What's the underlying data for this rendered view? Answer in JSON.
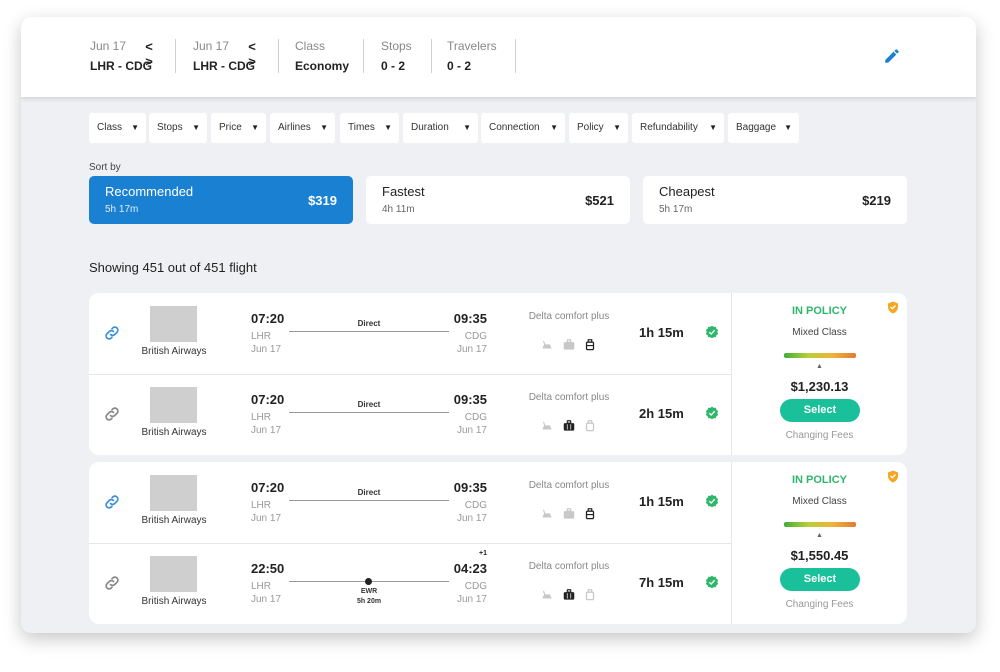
{
  "search": {
    "outbound_date": "Jun 17",
    "outbound_route": "LHR - CDG",
    "return_date": "Jun 17",
    "return_route": "LHR - CDG",
    "prev_glyph": "<",
    "next_glyph": ">",
    "class_label": "Class",
    "class_value": "Economy",
    "stops_label": "Stops",
    "stops_value": "0 - 2",
    "travelers_label": "Travelers",
    "travelers_value": "0 - 2",
    "edit_icon": "pencil-icon"
  },
  "filters": [
    "Class",
    "Stops",
    "Price",
    "Airlines",
    "Times",
    "Duration",
    "Connection",
    "Policy",
    "Refundability",
    "Baggage"
  ],
  "filter_caret": "▼",
  "sort": {
    "label": "Sort by",
    "options": [
      {
        "name": "Recommended",
        "duration": "5h 17m",
        "price": "$319"
      },
      {
        "name": "Fastest",
        "duration": "4h 11m",
        "price": "$521"
      },
      {
        "name": "Cheapest",
        "duration": "5h 17m",
        "price": "$219"
      }
    ]
  },
  "results_summary": "Showing 451 out of 451 flight",
  "groups": [
    {
      "policy_status": "IN POLICY",
      "class_mix": "Mixed Class",
      "policy_level": 0.6,
      "pointer_glyph": "▲",
      "price": "$1,230.13",
      "select_label": "Select",
      "fees_label": "Changing Fees",
      "flights": [
        {
          "airline": "British Airways",
          "dep_time": "07:20",
          "dep_code": "LHR",
          "dep_date": "Jun 17",
          "arr_time": "09:35",
          "arr_code": "CDG",
          "arr_date": "Jun 17",
          "route": "Direct",
          "fare": "Delta comfort plus",
          "duration": "1h 15m",
          "link_active": true,
          "bags": [
            false,
            false,
            true
          ]
        },
        {
          "airline": "British Airways",
          "dep_time": "07:20",
          "dep_code": "LHR",
          "dep_date": "Jun 17",
          "arr_time": "09:35",
          "arr_code": "CDG",
          "arr_date": "Jun 17",
          "route": "Direct",
          "fare": "Delta comfort plus",
          "duration": "2h 15m",
          "link_active": false,
          "bags": [
            false,
            true,
            false
          ]
        }
      ]
    },
    {
      "policy_status": "IN POLICY",
      "class_mix": "Mixed Class",
      "policy_level": 0.6,
      "pointer_glyph": "▲",
      "price": "$1,550.45",
      "select_label": "Select",
      "fees_label": "Changing Fees",
      "flights": [
        {
          "airline": "British Airways",
          "dep_time": "07:20",
          "dep_code": "LHR",
          "dep_date": "Jun 17",
          "arr_time": "09:35",
          "arr_code": "CDG",
          "arr_date": "Jun 17",
          "route": "Direct",
          "fare": "Delta comfort plus",
          "duration": "1h 15m",
          "link_active": true,
          "bags": [
            false,
            false,
            true
          ]
        },
        {
          "airline": "British Airways",
          "dep_time": "22:50",
          "dep_code": "LHR",
          "dep_date": "Jun 17",
          "arr_time": "04:23",
          "arr_day_offset": "+1",
          "arr_code": "CDG",
          "arr_date": "Jun 17",
          "stop_code": "EWR",
          "stop_time": "5h 20m",
          "fare": "Delta comfort plus",
          "duration": "7h 15m",
          "link_active": false,
          "bags": [
            false,
            true,
            false
          ]
        }
      ]
    }
  ],
  "colors": {
    "accent": "#1a80d2",
    "policy_green": "#2eb66b",
    "select_teal": "#19c09a",
    "badge_orange": "#f5a623",
    "link_blue": "#3a8fd8"
  }
}
